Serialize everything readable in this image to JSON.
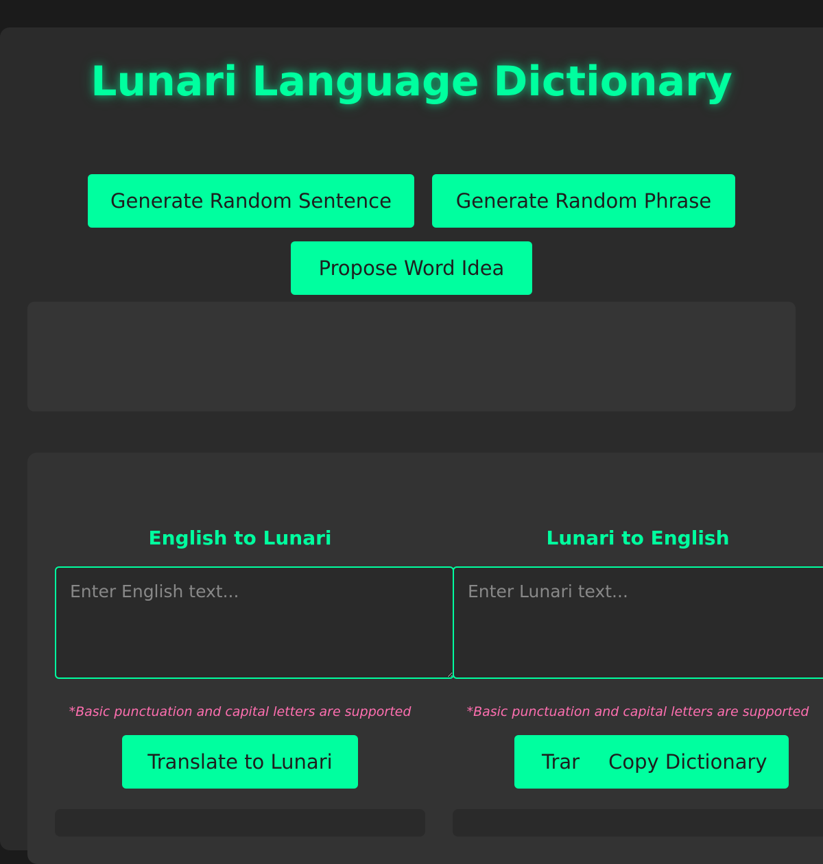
{
  "header": {
    "title": "Lunari Language Dictionary"
  },
  "actions": {
    "random_sentence": "Generate Random Sentence",
    "random_phrase": "Generate Random Phrase",
    "propose_word": "Propose Word Idea"
  },
  "output": {
    "text": ""
  },
  "translator": {
    "english_to_lunari": {
      "title": "English to Lunari",
      "placeholder": "Enter English text...",
      "note": "*Basic punctuation and capital letters are supported",
      "button": "Translate to Lunari"
    },
    "lunari_to_english": {
      "title": "Lunari to English",
      "placeholder": "Enter Lunari text...",
      "note": "*Basic punctuation and capital letters are supported",
      "button_partial": "Trar"
    }
  },
  "floating": {
    "copy_dictionary": "Copy Dictionary"
  },
  "colors": {
    "accent": "#00ff9f",
    "note": "#ff6fb0",
    "background": "#1b1b1b",
    "panel": "#2b2b2b"
  }
}
